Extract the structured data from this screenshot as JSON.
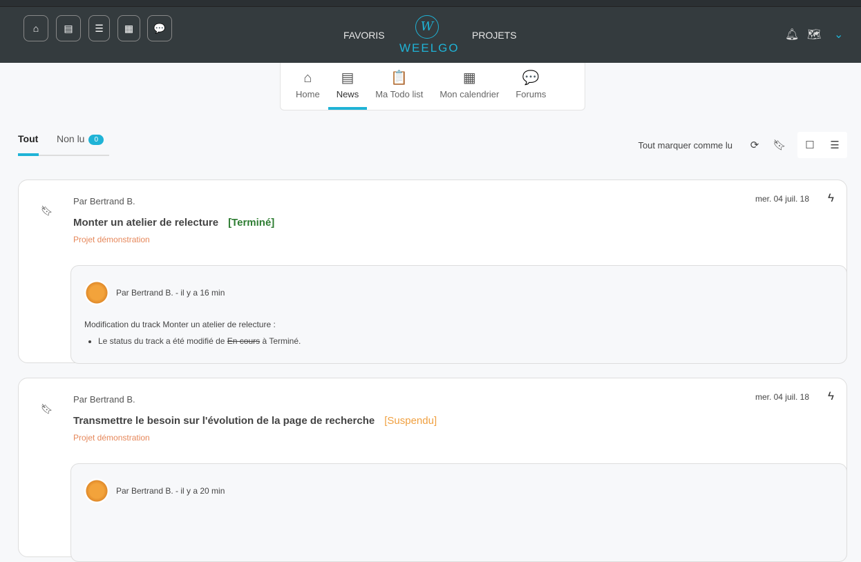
{
  "header": {
    "icons": [
      "home-icon",
      "newspaper-icon",
      "clipboard-icon",
      "calendar-icon",
      "comments-icon"
    ],
    "favoris": "FAVORIS",
    "projets": "PROJETS",
    "logo": "WEELGO",
    "logo_mark": "W"
  },
  "subnav": [
    {
      "icon": "⌂",
      "label": "Home"
    },
    {
      "icon": "▤",
      "label": "News"
    },
    {
      "icon": "📋",
      "label": "Ma Todo list"
    },
    {
      "icon": "▦",
      "label": "Mon calendrier"
    },
    {
      "icon": "💬",
      "label": "Forums"
    }
  ],
  "tabs": {
    "all": "Tout",
    "unread": "Non lu",
    "unread_count": "0"
  },
  "toolbar": {
    "mark_all": "Tout marquer comme lu"
  },
  "colors": {
    "accent": "#1fb3d6",
    "done": "#2e7d32",
    "suspended": "#f0a040",
    "project": "#e6875a"
  },
  "news": [
    {
      "author": "Par Bertrand B.",
      "title": "Monter un atelier de relecture",
      "status": "[Terminé]",
      "project": "Projet démonstration",
      "date": "mer. 04 juil. 18",
      "comment_author": "Par Bertrand B. - il y a 16 min",
      "comment_intro": "Modification du track Monter un atelier de relecture :",
      "change_prefix": "Le status du track a été modifié de",
      "old": "En cours",
      "change_mid": "à",
      "new": "Terminé."
    },
    {
      "author": "Par Bertrand B.",
      "title": "Transmettre le besoin sur l'évolution de la page de recherche",
      "status": "[Suspendu]",
      "project": "Projet démonstration",
      "date": "mer. 04 juil. 18",
      "comment_author": "Par Bertrand B. - il y a 20 min"
    }
  ]
}
